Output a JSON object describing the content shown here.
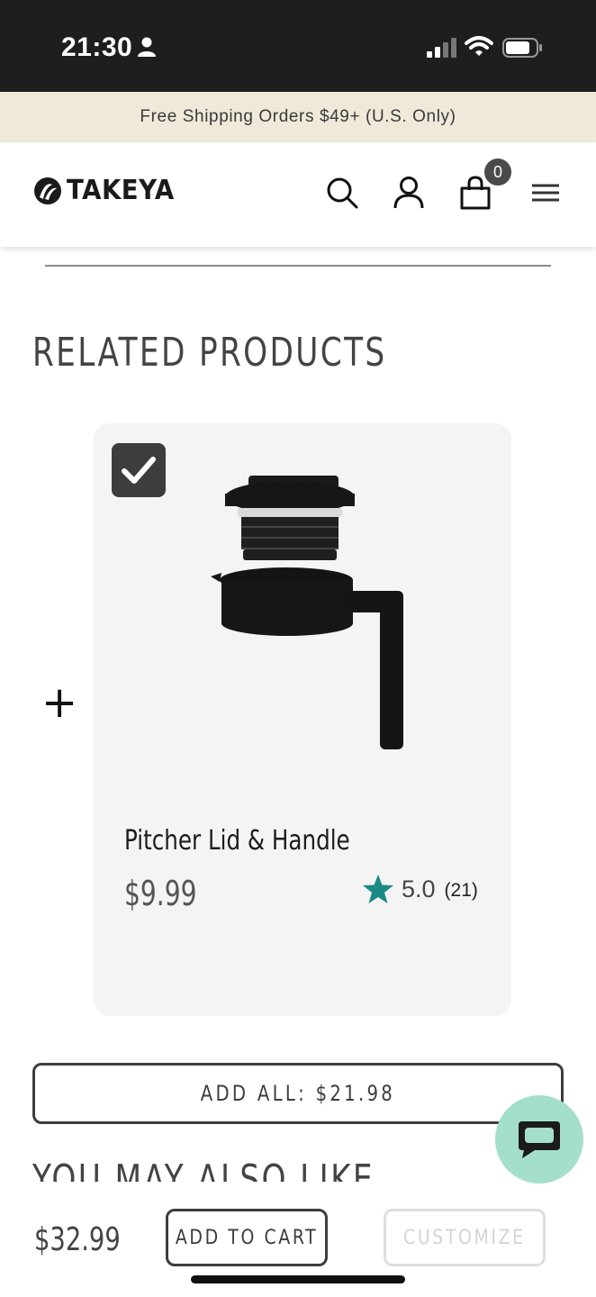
{
  "status_bar": {
    "time": "21:30"
  },
  "promo": {
    "text": "Free Shipping Orders $49+ (U.S. Only)"
  },
  "header": {
    "logo_text": "TAKEYA",
    "cart_count": "0"
  },
  "related": {
    "title": "RELATED PRODUCTS",
    "plus": "+",
    "product": {
      "name": "Pitcher Lid & Handle",
      "price": "$9.99",
      "rating": "5.0",
      "review_count": "(21)",
      "selected": true,
      "star_color": "#1a8a86"
    },
    "add_all_label": "ADD ALL: $21.98"
  },
  "also_like": {
    "title": "YOU MAY ALSO LIKE"
  },
  "bottom_bar": {
    "price": "$32.99",
    "add_to_cart_label": "ADD TO CART",
    "customize_label": "CUSTOMIZE"
  },
  "colors": {
    "promo_bg": "#f0e9d9",
    "chat_bubble": "#a4dfcc",
    "accent_star": "#1a8a86"
  },
  "icons": [
    "user-icon",
    "signal-icon",
    "wifi-icon",
    "battery-icon",
    "search-icon",
    "account-icon",
    "cart-icon",
    "menu-icon",
    "check-icon",
    "star-icon",
    "chat-icon"
  ]
}
